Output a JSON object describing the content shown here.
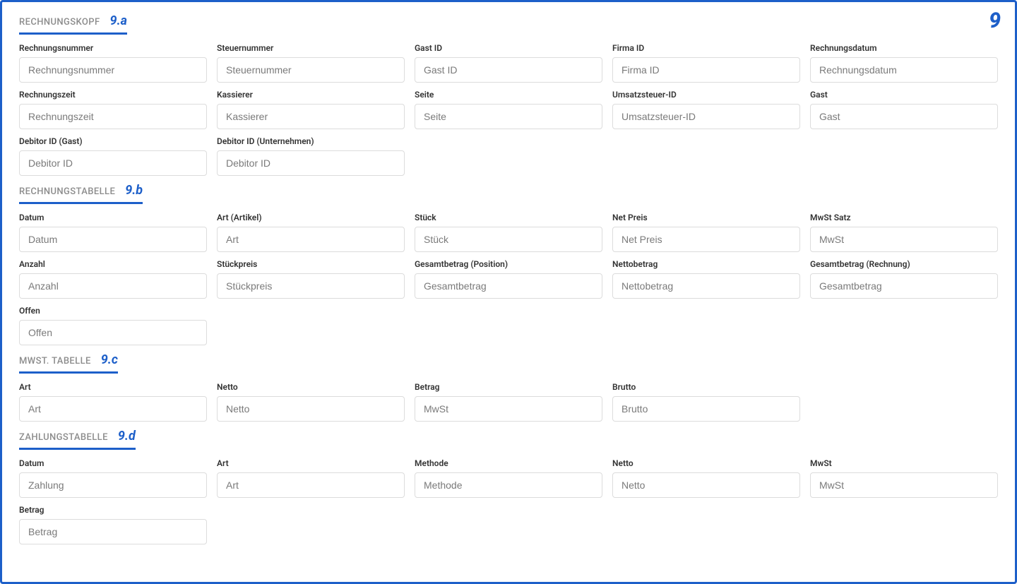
{
  "stepBadge": "9",
  "sections": {
    "kopf": {
      "title": "RECHNUNGSKOPF",
      "num": "9.a",
      "fields": {
        "rechnungsnummer": {
          "label": "Rechnungsnummer",
          "ph": "Rechnungsnummer"
        },
        "steuernummer": {
          "label": "Steuernummer",
          "ph": "Steuernummer"
        },
        "gastid": {
          "label": "Gast ID",
          "ph": "Gast ID"
        },
        "firmaid": {
          "label": "Firma ID",
          "ph": "Firma ID"
        },
        "rechnungsdatum": {
          "label": "Rechnungsdatum",
          "ph": "Rechnungsdatum"
        },
        "rechnungszeit": {
          "label": "Rechnungszeit",
          "ph": "Rechnungszeit"
        },
        "kassierer": {
          "label": "Kassierer",
          "ph": "Kassierer"
        },
        "seite": {
          "label": "Seite",
          "ph": "Seite"
        },
        "ustid": {
          "label": "Umsatzsteuer-ID",
          "ph": "Umsatzsteuer-ID"
        },
        "gast": {
          "label": "Gast",
          "ph": "Gast"
        },
        "debitorGast": {
          "label": "Debitor ID (Gast)",
          "ph": "Debitor ID"
        },
        "debitorUnternehmen": {
          "label": "Debitor ID (Unternehmen)",
          "ph": "Debitor ID"
        }
      }
    },
    "tabelle": {
      "title": "RECHNUNGSTABELLE",
      "num": "9.b",
      "fields": {
        "datum": {
          "label": "Datum",
          "ph": "Datum"
        },
        "artArtikel": {
          "label": "Art (Artikel)",
          "ph": "Art"
        },
        "stueck": {
          "label": "Stück",
          "ph": "Stück"
        },
        "netpreis": {
          "label": "Net Preis",
          "ph": "Net Preis"
        },
        "mwstSatz": {
          "label": "MwSt Satz",
          "ph": "MwSt"
        },
        "anzahl": {
          "label": "Anzahl",
          "ph": "Anzahl"
        },
        "stueckpreis": {
          "label": "Stückpreis",
          "ph": "Stückpreis"
        },
        "gesamtPos": {
          "label": "Gesamtbetrag (Position)",
          "ph": "Gesamtbetrag"
        },
        "nettobetrag": {
          "label": "Nettobetrag",
          "ph": "Nettobetrag"
        },
        "gesamtRechnung": {
          "label": "Gesamtbetrag (Rechnung)",
          "ph": "Gesamtbetrag"
        },
        "offen": {
          "label": "Offen",
          "ph": "Offen"
        }
      }
    },
    "mwst": {
      "title": "MWST. TABELLE",
      "num": "9.c",
      "fields": {
        "art": {
          "label": "Art",
          "ph": "Art"
        },
        "netto": {
          "label": "Netto",
          "ph": "Netto"
        },
        "betrag": {
          "label": "Betrag",
          "ph": "MwSt"
        },
        "brutto": {
          "label": "Brutto",
          "ph": "Brutto"
        }
      }
    },
    "zahlung": {
      "title": "ZAHLUNGSTABELLE",
      "num": "9.d",
      "fields": {
        "datum": {
          "label": "Datum",
          "ph": "Zahlung"
        },
        "art": {
          "label": "Art",
          "ph": "Art"
        },
        "methode": {
          "label": "Methode",
          "ph": "Methode"
        },
        "netto": {
          "label": "Netto",
          "ph": "Netto"
        },
        "mwst": {
          "label": "MwSt",
          "ph": "MwSt"
        },
        "betrag": {
          "label": "Betrag",
          "ph": "Betrag"
        }
      }
    }
  }
}
